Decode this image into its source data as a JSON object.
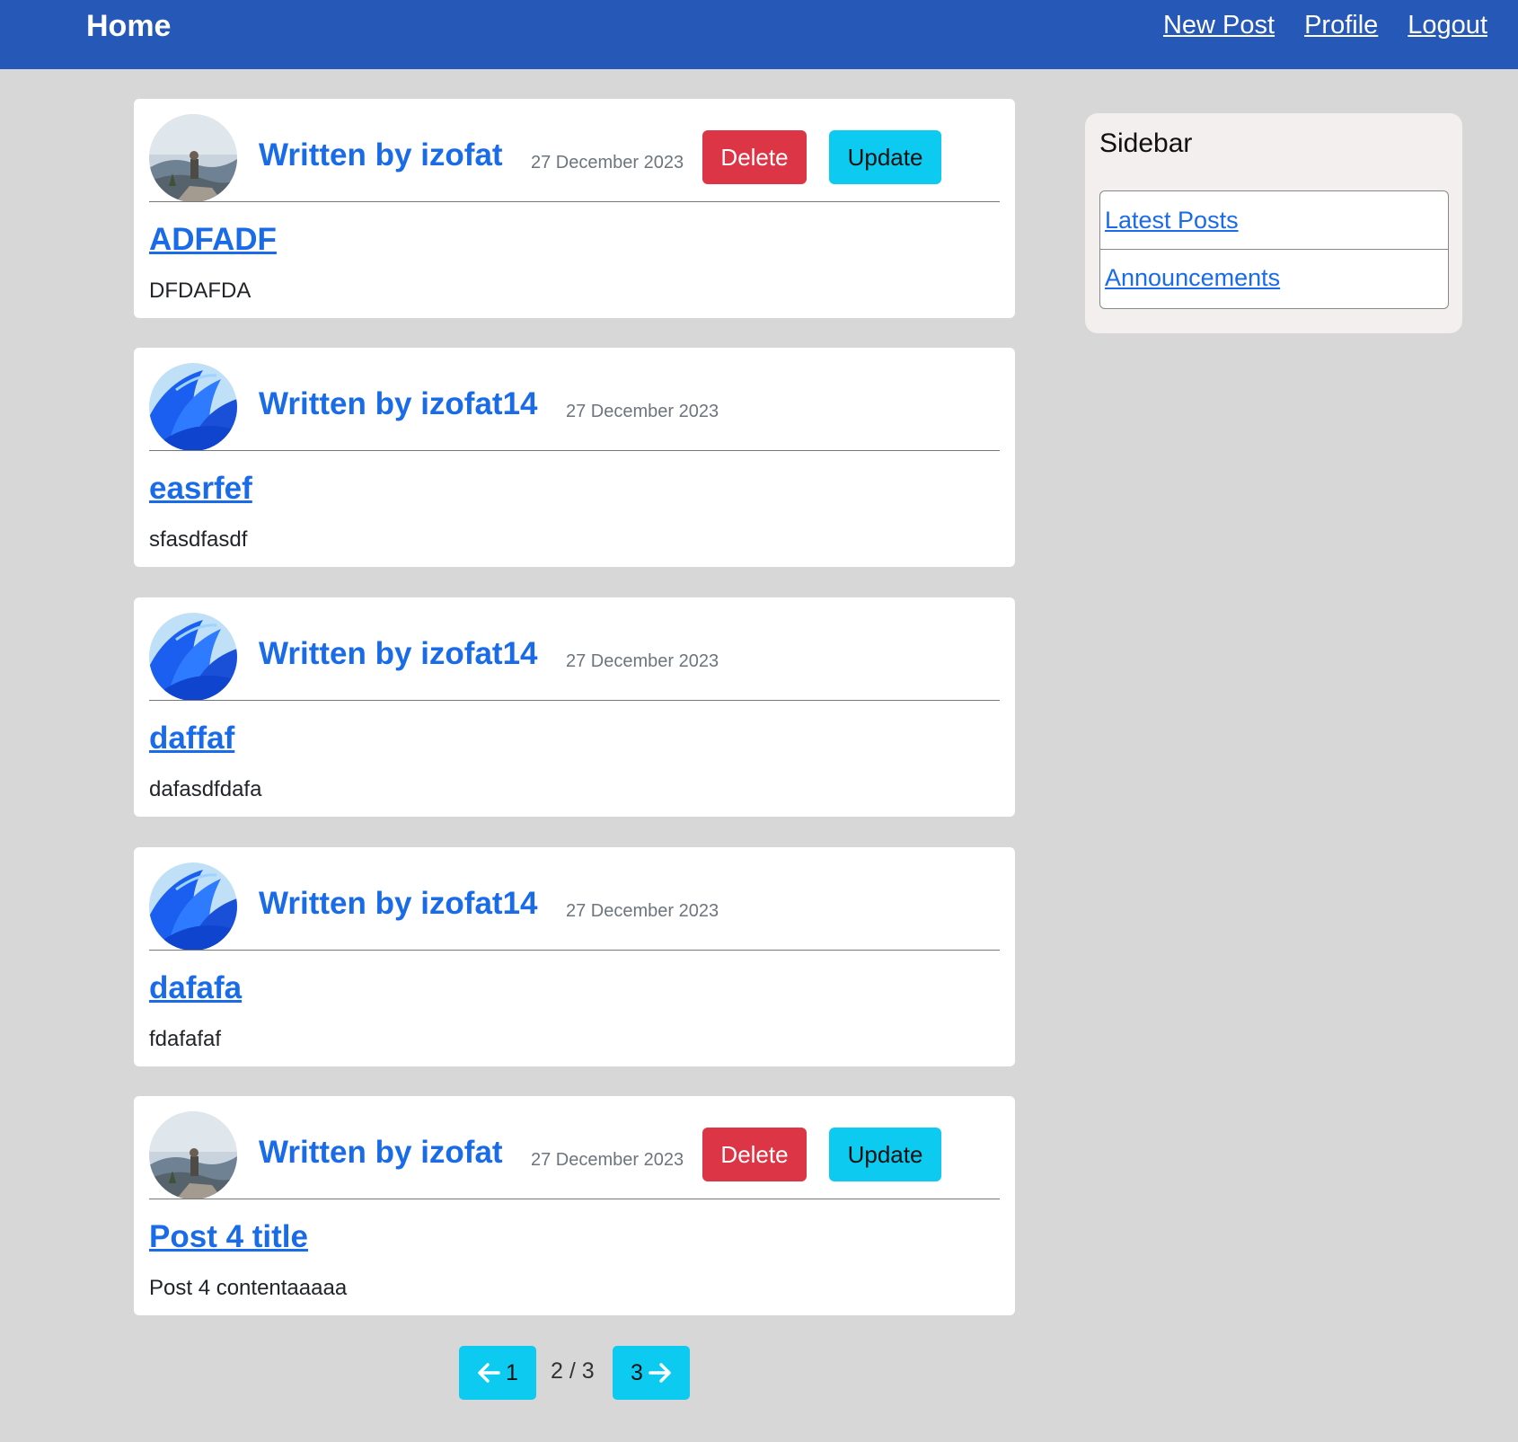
{
  "nav": {
    "brand": "Home",
    "links": [
      "New Post",
      "Profile",
      "Logout"
    ]
  },
  "posts": [
    {
      "author": "Written by izofat",
      "date": "27 December 2023",
      "title": "ADFADF",
      "content": "DFDAFDA",
      "owner": true,
      "avatar": "person-on-mountain-avatar"
    },
    {
      "author": "Written by izofat14",
      "date": "27 December 2023",
      "title": "easrfef",
      "content": "sfasdfasdf",
      "owner": false,
      "avatar": "blue-bloom-avatar"
    },
    {
      "author": "Written by izofat14",
      "date": "27 December 2023",
      "title": "daffaf",
      "content": "dafasdfdafa",
      "owner": false,
      "avatar": "blue-bloom-avatar"
    },
    {
      "author": "Written by izofat14",
      "date": "27 December 2023",
      "title": "dafafa",
      "content": "fdafafaf",
      "owner": false,
      "avatar": "blue-bloom-avatar"
    },
    {
      "author": "Written by izofat",
      "date": "27 December 2023",
      "title": "Post 4 title",
      "content": "Post 4 contentaaaaa",
      "owner": true,
      "avatar": "person-on-mountain-avatar"
    }
  ],
  "buttons": {
    "delete": "Delete",
    "update": "Update"
  },
  "sidebar": {
    "title": "Sidebar",
    "items": [
      "Latest Posts",
      "Announcements"
    ]
  },
  "pagination": {
    "prev_label": "1",
    "indicator": "2 / 3",
    "next_label": "3",
    "prev_icon": "arrow-left-icon",
    "next_icon": "arrow-right-icon"
  },
  "colors": {
    "navbar": "#2658b8",
    "background": "#d8d7d8",
    "link": "#1a6be8",
    "delete": "#dc3545",
    "update": "#0dcaf0",
    "date": "#6c757d"
  }
}
